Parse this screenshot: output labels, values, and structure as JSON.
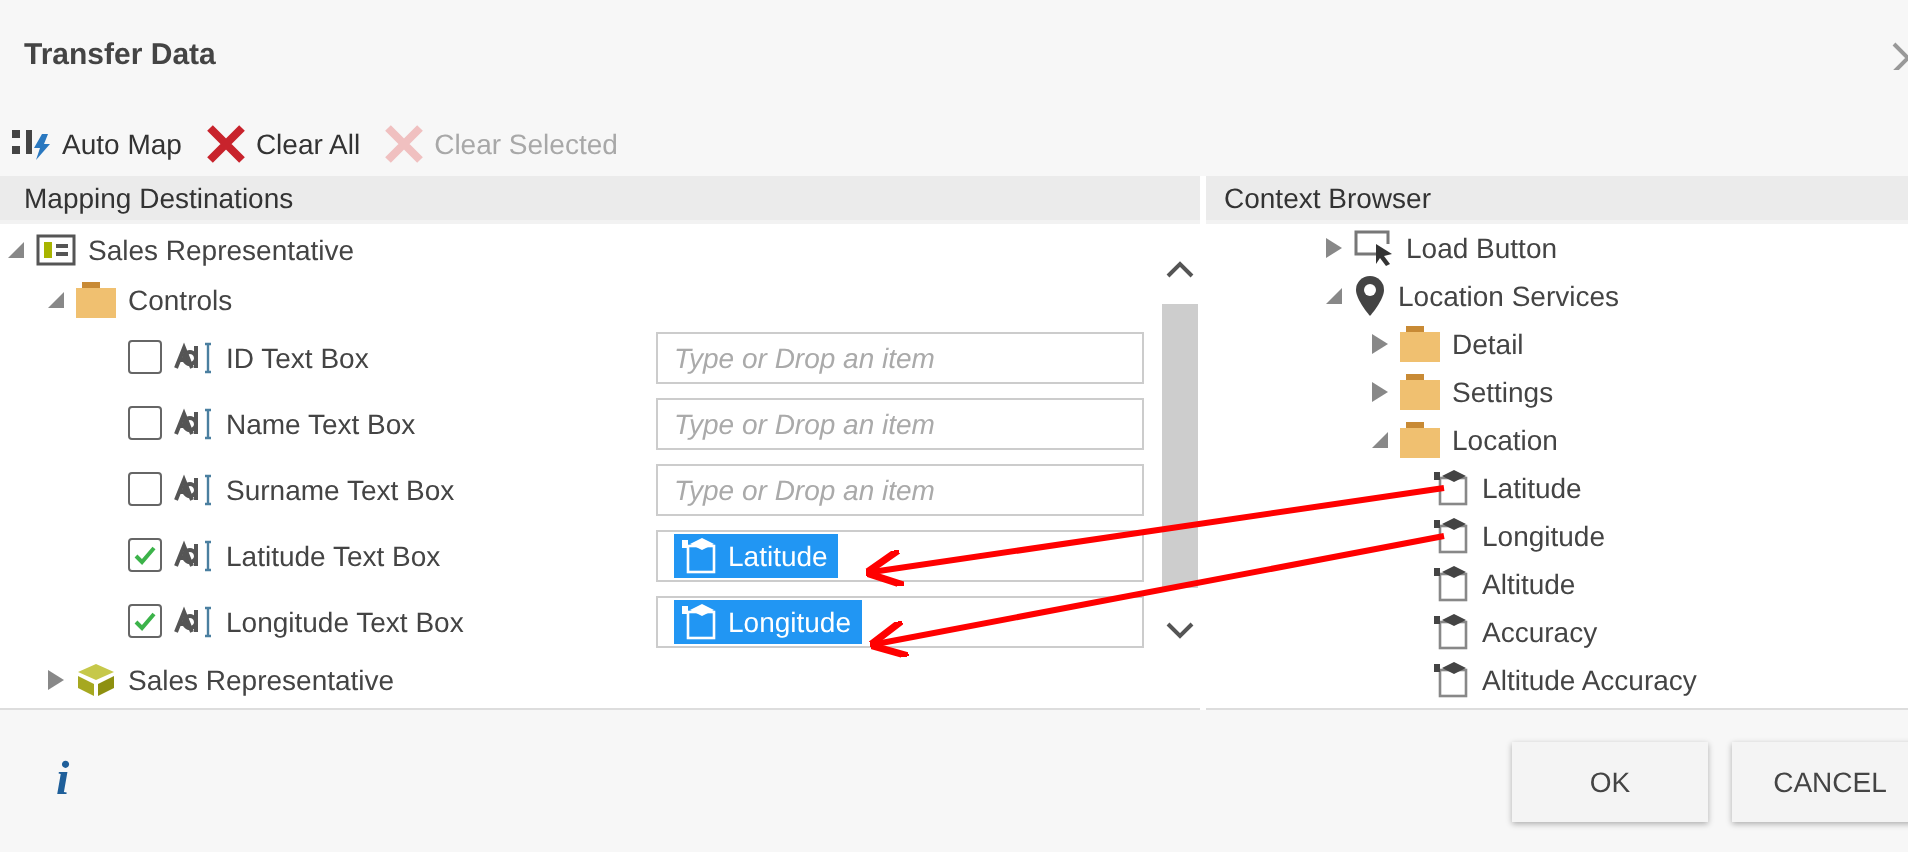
{
  "window": {
    "title": "Transfer Data"
  },
  "toolbar": [
    {
      "label": "Auto Map",
      "kind": "automap",
      "disabled": false
    },
    {
      "label": "Clear All",
      "kind": "clear",
      "disabled": false
    },
    {
      "label": "Clear Selected",
      "kind": "clear",
      "disabled": true
    }
  ],
  "mapping_destinations": {
    "header": "Mapping Destinations",
    "tree": [
      {
        "label": "Sales Representative",
        "kind": "form",
        "expanded": true,
        "children": [
          {
            "label": "Controls",
            "kind": "folder",
            "expanded": true,
            "fields": [
              {
                "label": "ID Text Box",
                "checked": false,
                "placeholder": "Type or Drop an item"
              },
              {
                "label": "Name Text Box",
                "checked": false,
                "placeholder": "Type or Drop an item"
              },
              {
                "label": "Surname Text Box",
                "checked": false,
                "placeholder": "Type or Drop an item"
              },
              {
                "label": "Latitude Text Box",
                "checked": true,
                "mapped": "Latitude"
              },
              {
                "label": "Longitude Text Box",
                "checked": true,
                "mapped": "Longitude"
              }
            ]
          },
          {
            "label": "Sales Representative",
            "kind": "entity",
            "expanded": false
          }
        ]
      }
    ]
  },
  "context_browser": {
    "header": "Context Browser",
    "tree": [
      {
        "label": "Load Button",
        "kind": "button",
        "expanded": false
      },
      {
        "label": "Location Services",
        "kind": "location",
        "expanded": true,
        "children": [
          {
            "label": "Detail",
            "kind": "folder",
            "expanded": false
          },
          {
            "label": "Settings",
            "kind": "folder",
            "expanded": false
          },
          {
            "label": "Location",
            "kind": "folder",
            "expanded": true,
            "children": [
              {
                "label": "Latitude",
                "kind": "property"
              },
              {
                "label": "Longitude",
                "kind": "property"
              },
              {
                "label": "Altitude",
                "kind": "property"
              },
              {
                "label": "Accuracy",
                "kind": "property"
              },
              {
                "label": "Altitude Accuracy",
                "kind": "property"
              }
            ]
          }
        ]
      }
    ]
  },
  "footer": {
    "info": "i",
    "buttons": [
      "OK",
      "CANCEL"
    ]
  }
}
